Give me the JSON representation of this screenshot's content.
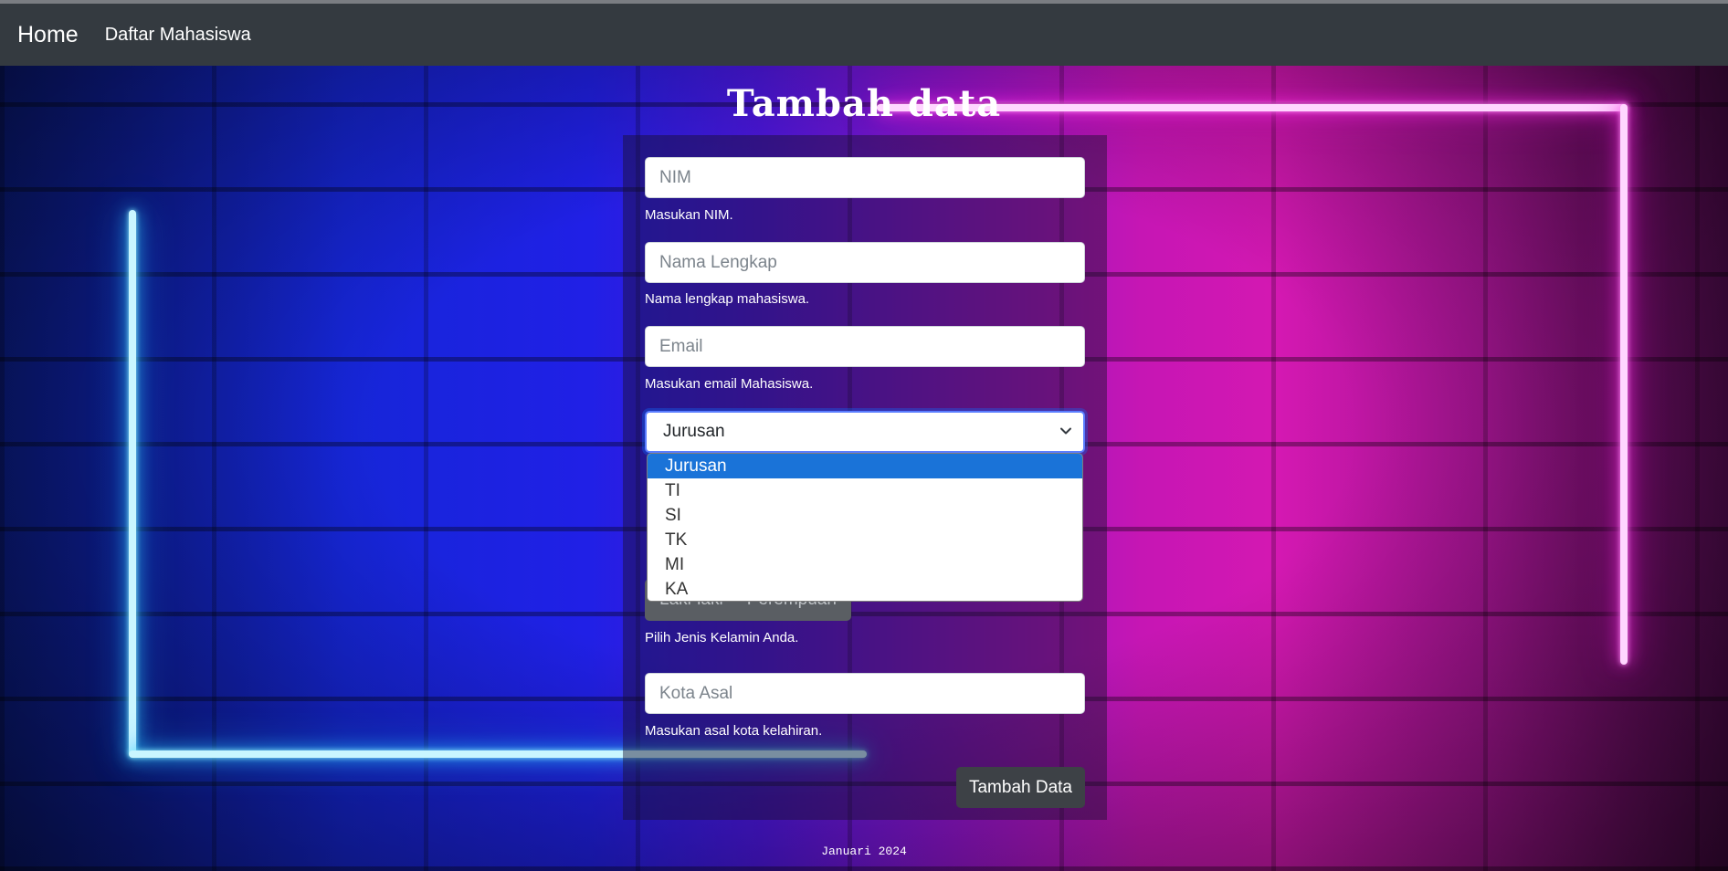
{
  "navbar": {
    "brand": "Home",
    "link": "Daftar Mahasiswa"
  },
  "title": "Tambah data",
  "form": {
    "nim": {
      "placeholder": "NIM",
      "help": "Masukan NIM."
    },
    "nama": {
      "placeholder": "Nama Lengkap",
      "help": "Nama lengkap mahasiswa."
    },
    "email": {
      "placeholder": "Email",
      "help": "Masukan email Mahasiswa."
    },
    "jurusan": {
      "selected": "Jurusan",
      "options": [
        "Jurusan",
        "TI",
        "SI",
        "TK",
        "MI",
        "KA"
      ]
    },
    "gender": {
      "options": [
        "Laki-laki",
        "Perempuan"
      ],
      "help": "Pilih Jenis Kelamin Anda."
    },
    "kota": {
      "placeholder": "Kota Asal",
      "help": "Masukan asal kota kelahiran."
    },
    "submit": "Tambah Data"
  },
  "footer": "Januari 2024",
  "colors": {
    "navbar": "#343a40",
    "dropdown_selected": "#1a73d8",
    "button": "#3d4146",
    "neon_blue": "#2fc8ff",
    "neon_pink": "#ff2ee6"
  }
}
